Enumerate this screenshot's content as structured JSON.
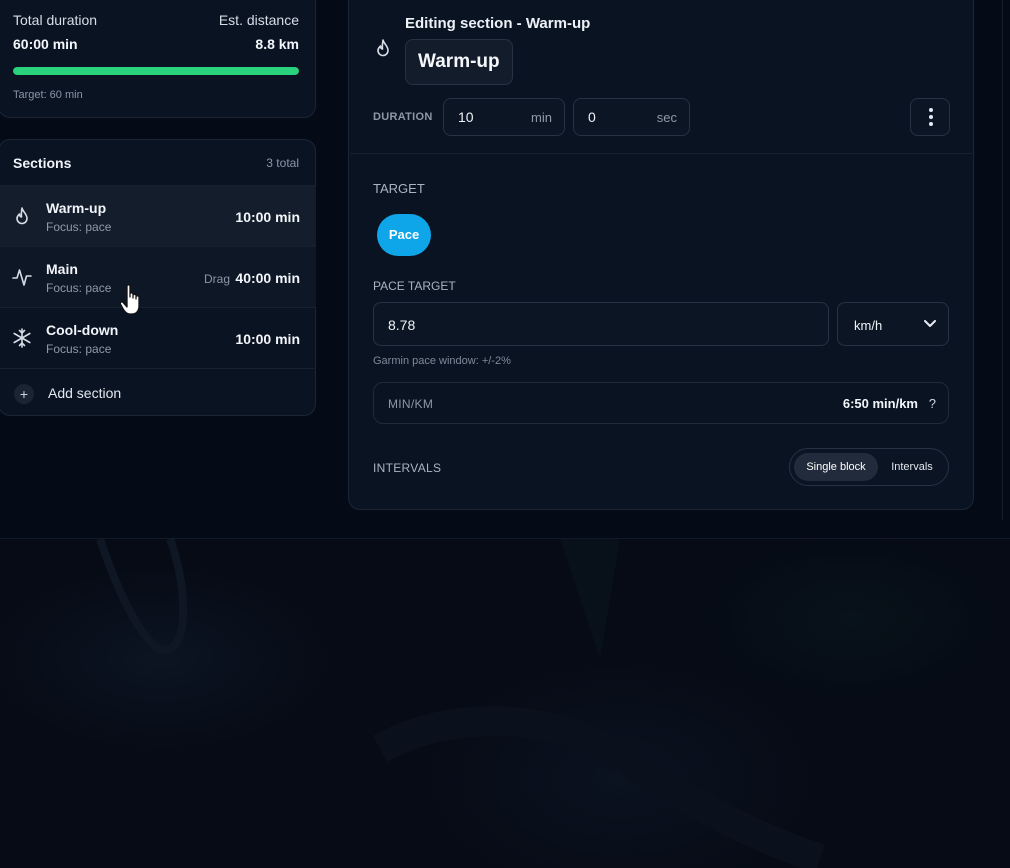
{
  "summary": {
    "duration_label": "Total duration",
    "duration_value": "60:00 min",
    "distance_label": "Est. distance",
    "distance_value": "8.8 km",
    "progress_percent": 100,
    "progress_color": "#2bd27e",
    "target_text": "Target: 60 min"
  },
  "sections": {
    "title": "Sections",
    "count": "3 total",
    "items": [
      {
        "icon": "flame-icon",
        "name": "Warm-up",
        "focus": "Focus: pace",
        "duration": "10:00 min",
        "state": "active"
      },
      {
        "icon": "pulse-icon",
        "name": "Main",
        "focus": "Focus: pace",
        "duration": "40:00 min",
        "drag_label": "Drag",
        "state": "hover"
      },
      {
        "icon": "snowflake-icon",
        "name": "Cool-down",
        "focus": "Focus: pace",
        "duration": "10:00 min",
        "state": "normal"
      }
    ],
    "add_label": "Add section"
  },
  "editor": {
    "heading": "Editing section - Warm-up",
    "name": "Warm-up",
    "duration_label": "DURATION",
    "minutes_value": "10",
    "minutes_unit": "min",
    "seconds_value": "0",
    "seconds_unit": "sec",
    "target_label": "TARGET",
    "target_option": "Pace",
    "pace_target_label": "PACE TARGET",
    "pace_value": "8.78",
    "unit_selected": "km/h",
    "garmin_hint": "Garmin pace window: +/-2%",
    "minkm_label": "MIN/KM",
    "minkm_value": "6:50 min/km",
    "help_mark": "?",
    "intervals_label": "INTERVALS",
    "interval_modes": [
      "Single block",
      "Intervals"
    ],
    "interval_selected": "Single block"
  },
  "colors": {
    "accent": "#0ea5e9",
    "progress": "#2bd27e",
    "background": "#050b16",
    "card": "#0a1322"
  }
}
